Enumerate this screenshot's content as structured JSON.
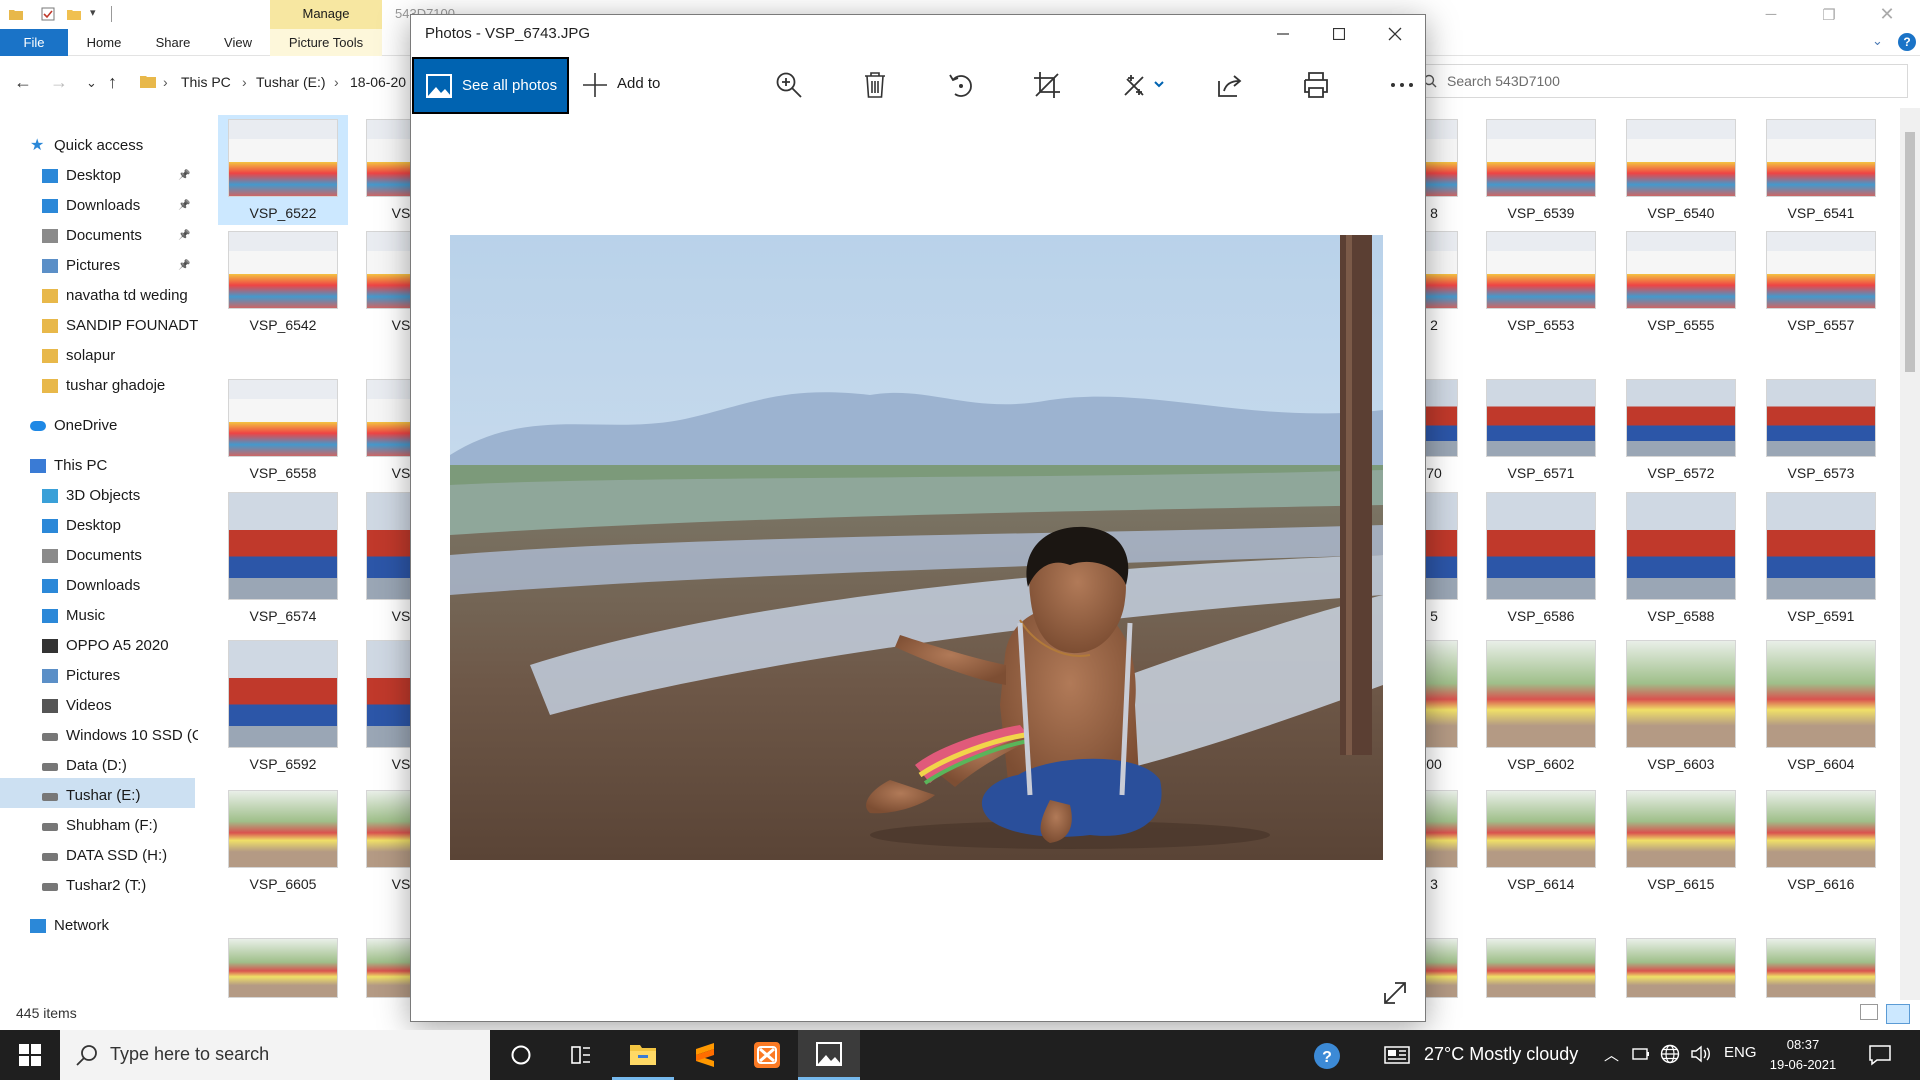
{
  "explorer": {
    "title": "543D7100",
    "contextual_tab": "Manage",
    "tabs": [
      "File",
      "Home",
      "Share",
      "View",
      "Picture Tools"
    ],
    "breadcrumb": [
      "This PC",
      "Tushar (E:)",
      "18-06-20"
    ],
    "search_placeholder": "Search 543D7100",
    "status": "445 items",
    "nav": {
      "quick_access": "Quick access",
      "quick_items": [
        {
          "label": "Desktop",
          "icon": "desktop-icon",
          "pinned": true
        },
        {
          "label": "Downloads",
          "icon": "downloads-icon",
          "pinned": true
        },
        {
          "label": "Documents",
          "icon": "documents-icon",
          "pinned": true
        },
        {
          "label": "Pictures",
          "icon": "pictures-icon",
          "pinned": true
        },
        {
          "label": "navatha td weding",
          "icon": "folder-icon",
          "pinned": false
        },
        {
          "label": "SANDIP FOUNADTIO",
          "icon": "folder-icon",
          "pinned": false
        },
        {
          "label": "solapur",
          "icon": "folder-icon",
          "pinned": false
        },
        {
          "label": "tushar ghadoje",
          "icon": "folder-icon",
          "pinned": false
        }
      ],
      "onedrive": "OneDrive",
      "this_pc": "This PC",
      "pc_items": [
        {
          "label": "3D Objects",
          "icon": "3d-objects-icon"
        },
        {
          "label": "Desktop",
          "icon": "desktop-icon"
        },
        {
          "label": "Documents",
          "icon": "documents-icon"
        },
        {
          "label": "Downloads",
          "icon": "downloads-icon"
        },
        {
          "label": "Music",
          "icon": "music-icon"
        },
        {
          "label": "OPPO A5 2020",
          "icon": "phone-icon"
        },
        {
          "label": "Pictures",
          "icon": "pictures-icon"
        },
        {
          "label": "Videos",
          "icon": "videos-icon"
        },
        {
          "label": "Windows 10 SSD (C",
          "icon": "drive-icon"
        },
        {
          "label": "Data (D:)",
          "icon": "drive-icon"
        },
        {
          "label": "Tushar (E:)",
          "icon": "drive-icon",
          "selected": true
        },
        {
          "label": "Shubham (F:)",
          "icon": "drive-icon"
        },
        {
          "label": "DATA SSD (H:)",
          "icon": "drive-icon"
        },
        {
          "label": "Tushar2 (T:)",
          "icon": "drive-icon"
        }
      ],
      "network": "Network"
    },
    "left_thumbs": [
      {
        "name": "VSP_6522",
        "selected": true,
        "tag": "party"
      },
      {
        "name": "VSP_6542",
        "tag": "party"
      },
      {
        "name": "VSP_6558",
        "tag": "party"
      },
      {
        "name": "VSP_6574",
        "tag": "portrait"
      },
      {
        "name": "VSP_6592",
        "tag": "portrait"
      },
      {
        "name": "VSP_6605",
        "tag": "outdoor"
      },
      {
        "name": "",
        "tag": "outdoor"
      }
    ],
    "col2_caption": "VS",
    "right_grid": [
      [
        "VSP_6539",
        "VSP_6540",
        "VSP_6541"
      ],
      [
        "VSP_6553",
        "VSP_6555",
        "VSP_6557"
      ],
      [
        "VSP_6571",
        "VSP_6572",
        "VSP_6573"
      ],
      [
        "VSP_6586",
        "VSP_6588",
        "VSP_6591"
      ],
      [
        "VSP_6602",
        "VSP_6603",
        "VSP_6604"
      ],
      [
        "VSP_6614",
        "VSP_6615",
        "VSP_6616"
      ],
      [
        "",
        "",
        ""
      ]
    ],
    "partial_captions": [
      "8",
      "2",
      "70",
      "5",
      "00",
      "3",
      ""
    ]
  },
  "photos": {
    "title": "Photos - VSP_6743.JPG",
    "see_all_label": "See all photos",
    "add_to_label": "Add to",
    "tools": [
      "zoom-in-icon",
      "delete-icon",
      "rotate-icon",
      "crop-icon",
      "edit-icon",
      "share-icon",
      "print-icon",
      "more-icon"
    ]
  },
  "taskbar": {
    "search_placeholder": "Type here to search",
    "weather": "27°C  Mostly cloudy",
    "language": "ENG",
    "time": "08:37",
    "date": "19-06-2021"
  },
  "colors": {
    "accent": "#0063b1",
    "file_tab": "#1a73c7",
    "manage_tab": "#f7e7a1",
    "selection": "#cce8ff",
    "taskbar": "#1f1f1f"
  }
}
